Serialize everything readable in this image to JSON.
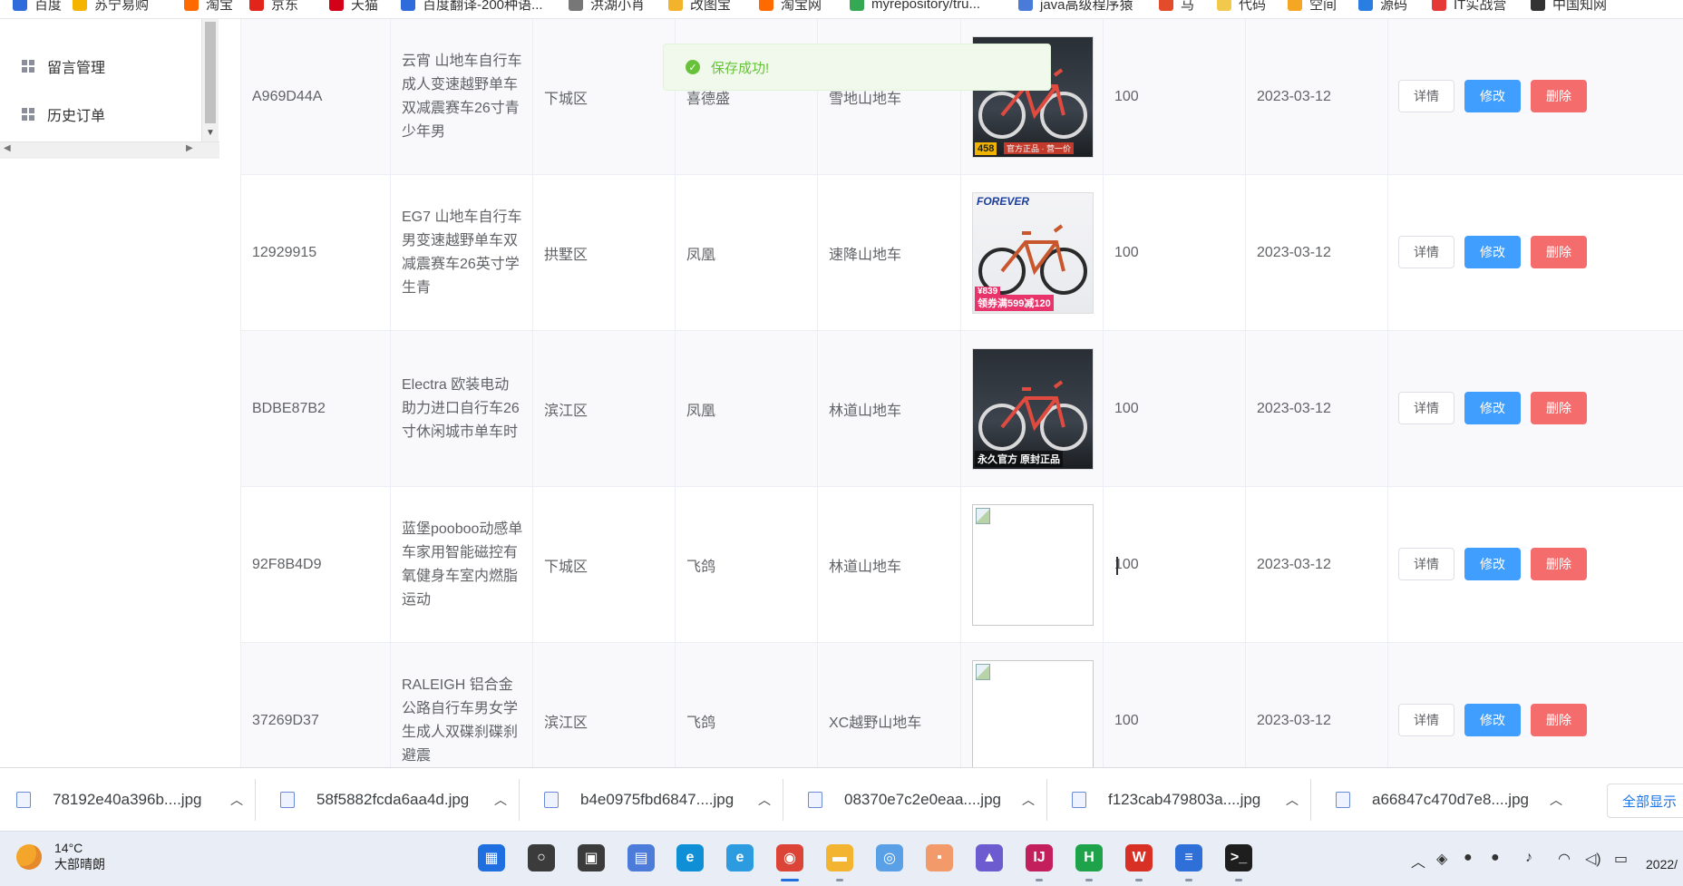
{
  "bookmarks": [
    {
      "label": "百度",
      "color": "#2f6bdb"
    },
    {
      "label": "苏宁易购",
      "color": "#f5b400"
    },
    {
      "label": "淘宝",
      "color": "#ff6a00"
    },
    {
      "label": "京东",
      "color": "#e1251b"
    },
    {
      "label": "天猫",
      "color": "#d4001a"
    },
    {
      "label": "百度翻译-200种语...",
      "color": "#2f6bdb"
    },
    {
      "label": "洪湖小肖",
      "color": "#777777"
    },
    {
      "label": "改图宝",
      "color": "#f3b32a"
    },
    {
      "label": "淘宝网",
      "color": "#ff6a00"
    },
    {
      "label": "myrepository/tru...",
      "color": "#34a853"
    },
    {
      "label": "java高级程序猿",
      "color": "#4a7bd8"
    },
    {
      "label": "马",
      "color": "#e44b2a"
    },
    {
      "label": "代码",
      "color": "#f2c94c"
    },
    {
      "label": "空间",
      "color": "#f5a623"
    },
    {
      "label": "源码",
      "color": "#2a7de1"
    },
    {
      "label": "IT实战营",
      "color": "#e53935"
    },
    {
      "label": "中国知网",
      "color": "#333333"
    }
  ],
  "sidebar": {
    "items": [
      {
        "label": "留言管理"
      },
      {
        "label": "历史订单"
      }
    ]
  },
  "toast": {
    "message": "保存成功!"
  },
  "actions": {
    "detail": "详情",
    "edit": "修改",
    "delete": "删除"
  },
  "rows": [
    {
      "id": "A969D44A",
      "name": "云宵 山地车自行车成人变速越野单车双减震赛车26寸青少年男",
      "district": "下城区",
      "brand": "喜德盛",
      "category": "雪地山地车",
      "image": "bike",
      "stock": "100",
      "date": "2023-03-12"
    },
    {
      "id": "12929915",
      "name": "EG7 山地车自行车男变速越野单车双减震赛车26英寸学生青",
      "district": "拱墅区",
      "brand": "凤凰",
      "category": "速降山地车",
      "image": "bike2",
      "stock": "100",
      "date": "2023-03-12"
    },
    {
      "id": "BDBE87B2",
      "name": "Electra 欧装电动助力进口自行车26寸休闲城市单车时",
      "district": "滨江区",
      "brand": "凤凰",
      "category": "林道山地车",
      "image": "bike",
      "stock": "100",
      "date": "2023-03-12"
    },
    {
      "id": "92F8B4D9",
      "name": "蓝堡pooboo动感单车家用智能磁控有氧健身车室内燃脂运动",
      "district": "下城区",
      "brand": "飞鸽",
      "category": "林道山地车",
      "image": "broken",
      "stock": "100",
      "date": "2023-03-12"
    },
    {
      "id": "37269D37",
      "name": "RALEIGH 铝合金公路自行车男女学生成人双碟刹碟刹避震",
      "district": "滨江区",
      "brand": "飞鸽",
      "category": "XC越野山地车",
      "image": "broken",
      "stock": "100",
      "date": "2023-03-12"
    }
  ],
  "image_text": {
    "promo_price": "458",
    "promo_caption": "官方正品 · 营一价",
    "forever_logo": "FOREVER",
    "forever_price": "¥839",
    "forever_promo": "领券满599减120",
    "official_caption": "永久官方 原封正品"
  },
  "downloads": {
    "files": [
      {
        "name": "78192e40a396b....jpg"
      },
      {
        "name": "58f5882fcda6aa4d.jpg"
      },
      {
        "name": "b4e0975fbd6847....jpg"
      },
      {
        "name": "08370e7c2e0eaa....jpg"
      },
      {
        "name": "f123cab479803a....jpg"
      },
      {
        "name": "a66847c470d7e8....jpg"
      }
    ],
    "show_all": "全部显示"
  },
  "taskbar": {
    "temperature": "14°C",
    "weather": "大部晴朗",
    "apps": [
      {
        "name": "windows-start-icon",
        "color": "#1f6fe0",
        "glyph": "▦"
      },
      {
        "name": "search-icon",
        "color": "#3b3b3b",
        "glyph": "○"
      },
      {
        "name": "task-view-icon",
        "color": "#3b3b3b",
        "glyph": "▣"
      },
      {
        "name": "network-tool-icon",
        "color": "#4c7bd9",
        "glyph": "▤"
      },
      {
        "name": "edge-icon",
        "color": "#0f8fd6",
        "glyph": "e"
      },
      {
        "name": "ie-browser-icon",
        "color": "#2c9be0",
        "glyph": "e"
      },
      {
        "name": "chrome-icon",
        "color": "#db4437",
        "glyph": "◉"
      },
      {
        "name": "file-explorer-icon",
        "color": "#f3b531",
        "glyph": "▬"
      },
      {
        "name": "photo-editor-icon",
        "color": "#5aa0e6",
        "glyph": "◎"
      },
      {
        "name": "media-app-icon",
        "color": "#f29a6a",
        "glyph": "▪"
      },
      {
        "name": "draw-app-icon",
        "color": "#6c5ccf",
        "glyph": "▲"
      },
      {
        "name": "intellij-icon",
        "color": "#c21f5c",
        "glyph": "IJ"
      },
      {
        "name": "hbuilder-icon",
        "color": "#1ea34a",
        "glyph": "H"
      },
      {
        "name": "wps-icon",
        "color": "#d93025",
        "glyph": "W"
      },
      {
        "name": "notepad-icon",
        "color": "#2f6fd8",
        "glyph": "≡"
      },
      {
        "name": "terminal-icon",
        "color": "#1e1e1e",
        "glyph": ">_"
      }
    ],
    "clock": "2022/"
  }
}
